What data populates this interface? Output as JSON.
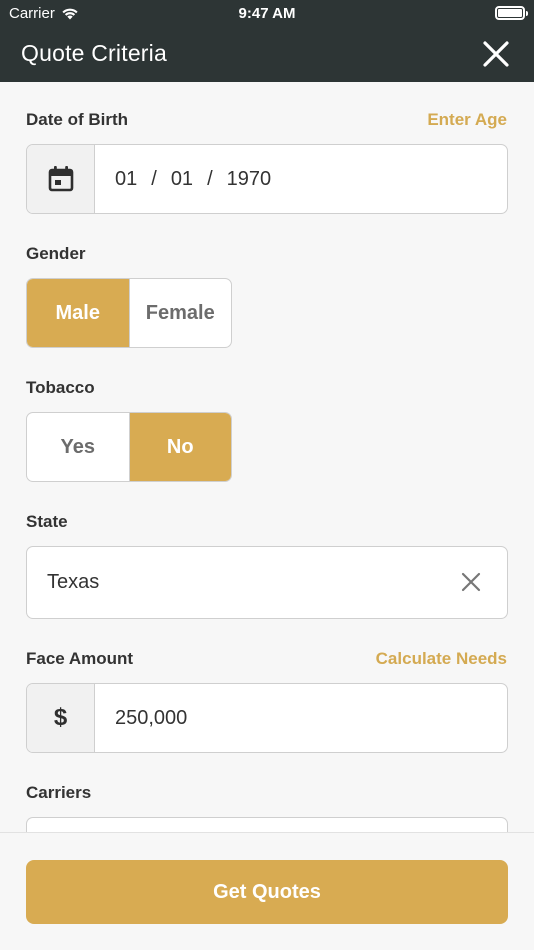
{
  "status_bar": {
    "carrier": "Carrier",
    "time": "9:47 AM"
  },
  "header": {
    "title": "Quote Criteria"
  },
  "dob": {
    "label": "Date of Birth",
    "link": "Enter Age",
    "month": "01",
    "day": "01",
    "year": "1970",
    "sep": "/"
  },
  "gender": {
    "label": "Gender",
    "options": [
      "Male",
      "Female"
    ],
    "selected": "Male"
  },
  "tobacco": {
    "label": "Tobacco",
    "options": [
      "Yes",
      "No"
    ],
    "selected": "No"
  },
  "state": {
    "label": "State",
    "value": "Texas"
  },
  "face_amount": {
    "label": "Face Amount",
    "link": "Calculate Needs",
    "currency": "$",
    "value": "250,000"
  },
  "carriers": {
    "label": "Carriers"
  },
  "cta": {
    "label": "Get Quotes"
  },
  "colors": {
    "header_bg": "#2d3535",
    "accent": "#d8ab52",
    "background": "#f7f7f7"
  }
}
